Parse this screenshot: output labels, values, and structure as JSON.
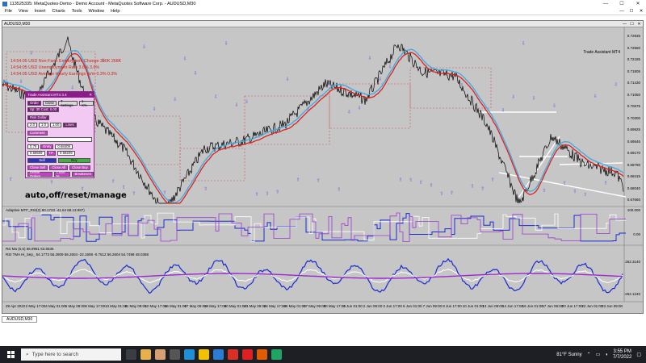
{
  "window": {
    "title": "113525335: MetaQuotes-Demo - Demo Account - MetaQuotes Software Corp. - AUDUSD,M30",
    "min": "—",
    "max": "☐",
    "close": "✕"
  },
  "menu": [
    "File",
    "View",
    "Insert",
    "Charts",
    "Tools",
    "Window",
    "Help"
  ],
  "chart": {
    "title": "AUDUSD,M30",
    "ta_label": "Trade Assistant MT4",
    "overlay_text": "auto,off/reset/manage",
    "news": [
      "14:54:05   USD  Non-Farm Employment Change     390K  268K",
      "14:54:05   USD  Unemployment Rate                 3.6%   3.6%",
      "14:54:05   USD  Average Hourly Earnings m/m      0.3%   0.3%"
    ],
    "prices": [
      "0.72935",
      "0.72560",
      "0.72185",
      "0.71805",
      "0.71430",
      "0.71050",
      "0.70675",
      "0.70300",
      "0.69925",
      "0.69545",
      "0.69170",
      "0.68790",
      "0.68415",
      "0.68040",
      "0.67660"
    ],
    "indicator1_label": "Adaptive MTF_RSI(2) 90.1723 -41.64 68.13.997)",
    "indicator2_label": "Rsi Ma (5,5) 66.9961 63.5536",
    "indicator3_label": "RSI TMA Hi_Sep_ 54.1773 56.2809 56.2604 -22.1608 -0.7512 56.2604 54.7498 48.0368",
    "ind_prices": [
      "100.000",
      "0.00",
      "262.3140",
      "-262.1240"
    ],
    "time_labels": [
      "29 Apr 2022",
      "2 May 17:00",
      "4 May 01:00",
      "5 May 09:00",
      "6 May 17:00",
      "10 May 01:00",
      "11 May 09:00",
      "12 May 17:00",
      "16 May 01:00",
      "17 May 09:00",
      "18 May 17:00",
      "20 May 01:00",
      "23 May 09:00",
      "24 May 17:00",
      "26 May 01:00",
      "27 May 09:00",
      "30 May 17:00",
      "1 Jun 01:00",
      "2 Jun 09:00",
      "3 Jun 17:00",
      "6 Jun 01:00",
      "7 Jun 09:00",
      "8 Jun 17:00",
      "10 Jun 01:00",
      "13 Jun 09:00",
      "14 Jun 17:00",
      "16 Jun 01:00",
      "17 Jun 09:00",
      "20 Jun 17:00",
      "22 Jun 01:00",
      "23 Jun 09:00"
    ]
  },
  "trade_panel": {
    "header": "Trade Assistant MT4  3.4",
    "row1": [
      "Order",
      "Close",
      "T Settings",
      "1 - X%"
    ],
    "row2": "Sp: 30  Cost: 0.00",
    "row3": [
      "Risk Dollar"
    ],
    "row4": [
      "2.0",
      "1.0",
      "1.00",
      "Lines"
    ],
    "comment_label": "Comment",
    "lot_label": "0.79",
    "entry_label": "Entry",
    "entry_value": "0.68409",
    "sl_value": "0.68509",
    "tp_value": "0.68209",
    "sell": "Sell",
    "buy": "Buy",
    "close_sell": "Close Sell",
    "close_all": "Close All",
    "close_buy": "Close Buy",
    "delete_orders": "Delete Orders",
    "close_pct": "Close %",
    "breakeven": "Breakeven"
  },
  "tabs": [
    "AUDUSD,M30"
  ],
  "taskbar": {
    "search_placeholder": "Type here to search",
    "weather": "81°F  Sunny",
    "time": "3:55 PM",
    "date": "7/7/2022"
  },
  "colors": {
    "chart_bg": "#c6c6c6",
    "price_line": "#000000",
    "ma_red": "#e02020",
    "ma_blue": "#3fa9e0",
    "arrow_blue": "#5a5ae0",
    "panel_purple": "#8b1a8b",
    "taskbar": "#1d1f25"
  }
}
